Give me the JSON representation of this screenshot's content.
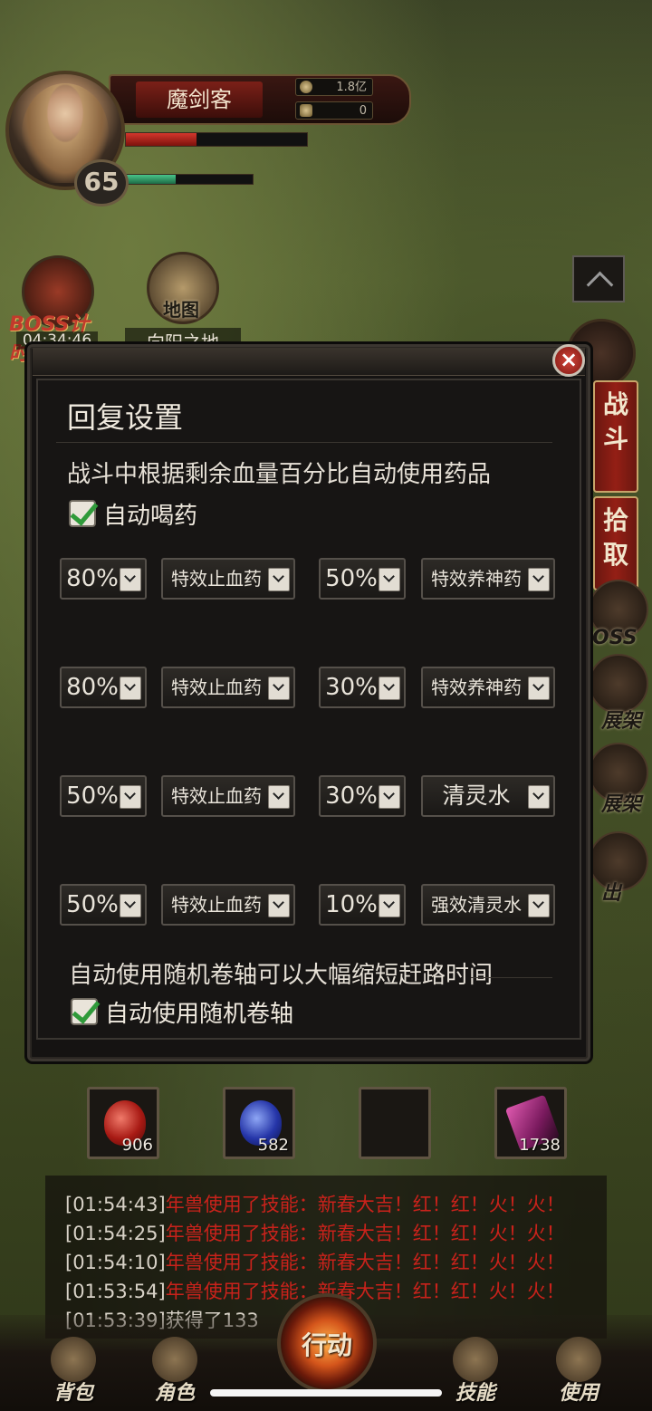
{
  "player": {
    "name": "魔剑客",
    "level": "65",
    "currency_gold": "1.8亿",
    "currency_ingot": "0",
    "hp_fraction": 0.39,
    "mp_fraction": 0.39
  },
  "hud": {
    "boss_timer_label": "BOSS计时",
    "boss_timer_value": "04:34:46",
    "map_label": "地图",
    "zone_name": "向阳之地"
  },
  "side_tabs": {
    "battle": "战斗",
    "pickup": "拾取",
    "boss_text": "OSS",
    "stall_1": "展架",
    "stall_2": "展架",
    "exit": "出"
  },
  "dialog": {
    "title": "回复设置",
    "description": "战斗中根据剩余血量百分比自动使用药品",
    "auto_drink_label": "自动喝药",
    "rows": [
      {
        "hp_pct": "80%",
        "hp_item": "特效止血药",
        "mp_pct": "50%",
        "mp_item": "特效养神药"
      },
      {
        "hp_pct": "80%",
        "hp_item": "特效止血药",
        "mp_pct": "30%",
        "mp_item": "特效养神药"
      },
      {
        "hp_pct": "50%",
        "hp_item": "特效止血药",
        "mp_pct": "30%",
        "mp_item": "清灵水"
      },
      {
        "hp_pct": "50%",
        "hp_item": "特效止血药",
        "mp_pct": "10%",
        "mp_item": "强效清灵水"
      }
    ],
    "scroll_description": "自动使用随机卷轴可以大幅缩短赶路时间",
    "auto_scroll_label": "自动使用随机卷轴",
    "close_symbol": "×"
  },
  "quick_slots": [
    {
      "count": "906"
    },
    {
      "count": "582"
    },
    {
      "count": ""
    },
    {
      "count": "1738"
    }
  ],
  "log": [
    {
      "time": "[01:54:43]",
      "text": "年兽使用了技能：新春大吉！红！红！火！火！"
    },
    {
      "time": "[01:54:25]",
      "text": "年兽使用了技能：新春大吉！红！红！火！火！"
    },
    {
      "time": "[01:54:10]",
      "text": "年兽使用了技能：新春大吉！红！红！火！火！"
    },
    {
      "time": "[01:53:54]",
      "text": "年兽使用了技能：新春大吉！红！红！火！火！"
    },
    {
      "time": "[01:53:39]",
      "text": "获得了133"
    }
  ],
  "bottom_nav": {
    "bag": "背包",
    "role": "角色",
    "action": "行动",
    "skill": "技能",
    "use": "使用"
  }
}
